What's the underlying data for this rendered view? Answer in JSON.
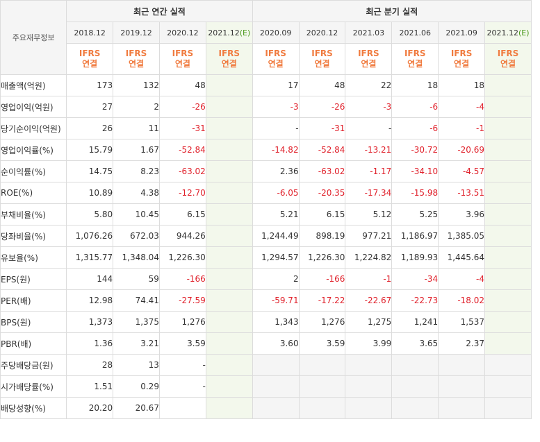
{
  "header": {
    "label_col": "주요재무정보",
    "annual_group": "최근 연간 실적",
    "quarter_group": "최근 분기 실적",
    "annual_periods": [
      "2018.12",
      "2019.12",
      "2020.12",
      "2021.12(E)"
    ],
    "quarter_periods": [
      "2020.09",
      "2020.12",
      "2021.03",
      "2021.06",
      "2021.09",
      "2021.12(E)"
    ],
    "ifrs_top": "IFRS",
    "ifrs_bottom": "연결"
  },
  "colors": {
    "negative": "#e0202a",
    "ifrs": "#f07b3f",
    "estimate_bg": "#f3f8ec",
    "header_bg": "#f5f5f5"
  },
  "rows": [
    {
      "label": "매출액(억원)",
      "annual": [
        "173",
        "132",
        "48",
        ""
      ],
      "quarter": [
        "17",
        "48",
        "22",
        "18",
        "18",
        ""
      ],
      "gtop": false
    },
    {
      "label": "영업이익(억원)",
      "annual": [
        "27",
        "2",
        "-26",
        ""
      ],
      "quarter": [
        "-3",
        "-26",
        "-3",
        "-6",
        "-4",
        ""
      ],
      "gtop": false
    },
    {
      "label": "당기순이익(억원)",
      "annual": [
        "26",
        "11",
        "-31",
        ""
      ],
      "quarter": [
        "-",
        "-31",
        "-",
        "-6",
        "-1",
        ""
      ],
      "gtop": false
    },
    {
      "label": "영업이익률(%)",
      "annual": [
        "15.79",
        "1.67",
        "-52.84",
        ""
      ],
      "quarter": [
        "-14.82",
        "-52.84",
        "-13.21",
        "-30.72",
        "-20.69",
        ""
      ],
      "gtop": true
    },
    {
      "label": "순이익률(%)",
      "annual": [
        "14.75",
        "8.23",
        "-63.02",
        ""
      ],
      "quarter": [
        "2.36",
        "-63.02",
        "-1.17",
        "-34.10",
        "-4.57",
        ""
      ],
      "gtop": false
    },
    {
      "label": "ROE(%)",
      "annual": [
        "10.89",
        "4.38",
        "-12.70",
        ""
      ],
      "quarter": [
        "-6.05",
        "-20.35",
        "-17.34",
        "-15.98",
        "-13.51",
        ""
      ],
      "gtop": false
    },
    {
      "label": "부채비율(%)",
      "annual": [
        "5.80",
        "10.45",
        "6.15",
        ""
      ],
      "quarter": [
        "5.21",
        "6.15",
        "5.12",
        "5.25",
        "3.96",
        ""
      ],
      "gtop": true
    },
    {
      "label": "당좌비율(%)",
      "annual": [
        "1,076.26",
        "672.03",
        "944.26",
        ""
      ],
      "quarter": [
        "1,244.49",
        "898.19",
        "977.21",
        "1,186.97",
        "1,385.05",
        ""
      ],
      "gtop": false
    },
    {
      "label": "유보율(%)",
      "annual": [
        "1,315.77",
        "1,348.04",
        "1,226.30",
        ""
      ],
      "quarter": [
        "1,294.57",
        "1,226.30",
        "1,224.82",
        "1,189.93",
        "1,445.64",
        ""
      ],
      "gtop": false
    },
    {
      "label": "EPS(원)",
      "annual": [
        "144",
        "59",
        "-166",
        ""
      ],
      "quarter": [
        "2",
        "-166",
        "-1",
        "-34",
        "-4",
        ""
      ],
      "gtop": true
    },
    {
      "label": "PER(배)",
      "annual": [
        "12.98",
        "74.41",
        "-27.59",
        ""
      ],
      "quarter": [
        "-59.71",
        "-17.22",
        "-22.67",
        "-22.73",
        "-18.02",
        ""
      ],
      "gtop": false
    },
    {
      "label": "BPS(원)",
      "annual": [
        "1,373",
        "1,375",
        "1,276",
        ""
      ],
      "quarter": [
        "1,343",
        "1,276",
        "1,275",
        "1,241",
        "1,537",
        ""
      ],
      "gtop": false
    },
    {
      "label": "PBR(배)",
      "annual": [
        "1.36",
        "3.21",
        "3.59",
        ""
      ],
      "quarter": [
        "3.60",
        "3.59",
        "3.99",
        "3.65",
        "2.37",
        ""
      ],
      "gtop": false
    },
    {
      "label": "주당배당금(원)",
      "annual": [
        "28",
        "13",
        "-",
        ""
      ],
      "quarter": null,
      "gtop": true
    },
    {
      "label": "시가배당률(%)",
      "annual": [
        "1.51",
        "0.29",
        "-",
        ""
      ],
      "quarter": null,
      "gtop": false
    },
    {
      "label": "배당성향(%)",
      "annual": [
        "20.20",
        "20.67",
        "",
        ""
      ],
      "quarter": null,
      "gtop": false
    }
  ]
}
